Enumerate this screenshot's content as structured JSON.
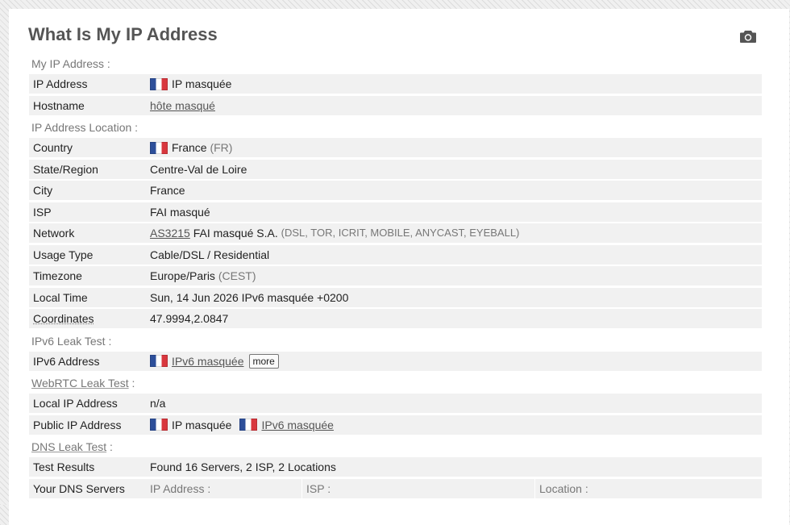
{
  "page": {
    "title": "What Is My IP Address",
    "camera_icon": "camera-icon"
  },
  "sections": {
    "my_ip": "My IP Address :",
    "location": "IP Address Location :",
    "ipv6_leak": "IPv6 Leak Test :",
    "webrtc_leak": "WebRTC Leak Test",
    "dns_leak": "DNS Leak Test",
    "colon": " :"
  },
  "rows": {
    "ip_address": {
      "label": "IP Address",
      "value": "IP masquée"
    },
    "hostname": {
      "label": "Hostname",
      "value": "hôte masqué"
    },
    "country": {
      "label": "Country",
      "value": "France",
      "code": "(FR)"
    },
    "state": {
      "label": "State/Region",
      "value": "Centre-Val de Loire"
    },
    "city": {
      "label": "City",
      "value": "France"
    },
    "isp": {
      "label": "ISP",
      "value": "FAI masqué"
    },
    "network": {
      "label": "Network",
      "asn": "AS3215",
      "name": "FAI masqué S.A.",
      "tags": "(DSL, TOR, ICRIT, MOBILE, ANYCAST, EYEBALL)"
    },
    "usage_type": {
      "label": "Usage Type",
      "value": "Cable/DSL / Residential"
    },
    "timezone": {
      "label": "Timezone",
      "value": "Europe/Paris",
      "abbr": "(CEST)"
    },
    "local_time": {
      "label": "Local Time",
      "value": "Sun, 14 Jun 2026 IPv6 masquée +0200"
    },
    "coordinates": {
      "label": "Coordinates",
      "value": "47.9994,2.0847"
    },
    "ipv6_address": {
      "label": "IPv6 Address",
      "value": "IPv6 masquée",
      "more": "more"
    },
    "local_ip": {
      "label": "Local IP Address",
      "value": "n/a"
    },
    "public_ip": {
      "label": "Public IP Address",
      "ipv4": "IP masquée",
      "ipv6": "IPv6 masquée"
    },
    "test_results": {
      "label": "Test Results",
      "value": "Found 16 Servers, 2 ISP, 2 Locations"
    },
    "dns_servers": {
      "label": "Your DNS Servers",
      "col_ip": "IP Address :",
      "col_isp": "ISP :",
      "col_location": "Location :"
    }
  },
  "colors": {
    "flag_blue": "#2d4f9a",
    "flag_red": "#d8373e",
    "row_background": "#f1f1f1"
  }
}
